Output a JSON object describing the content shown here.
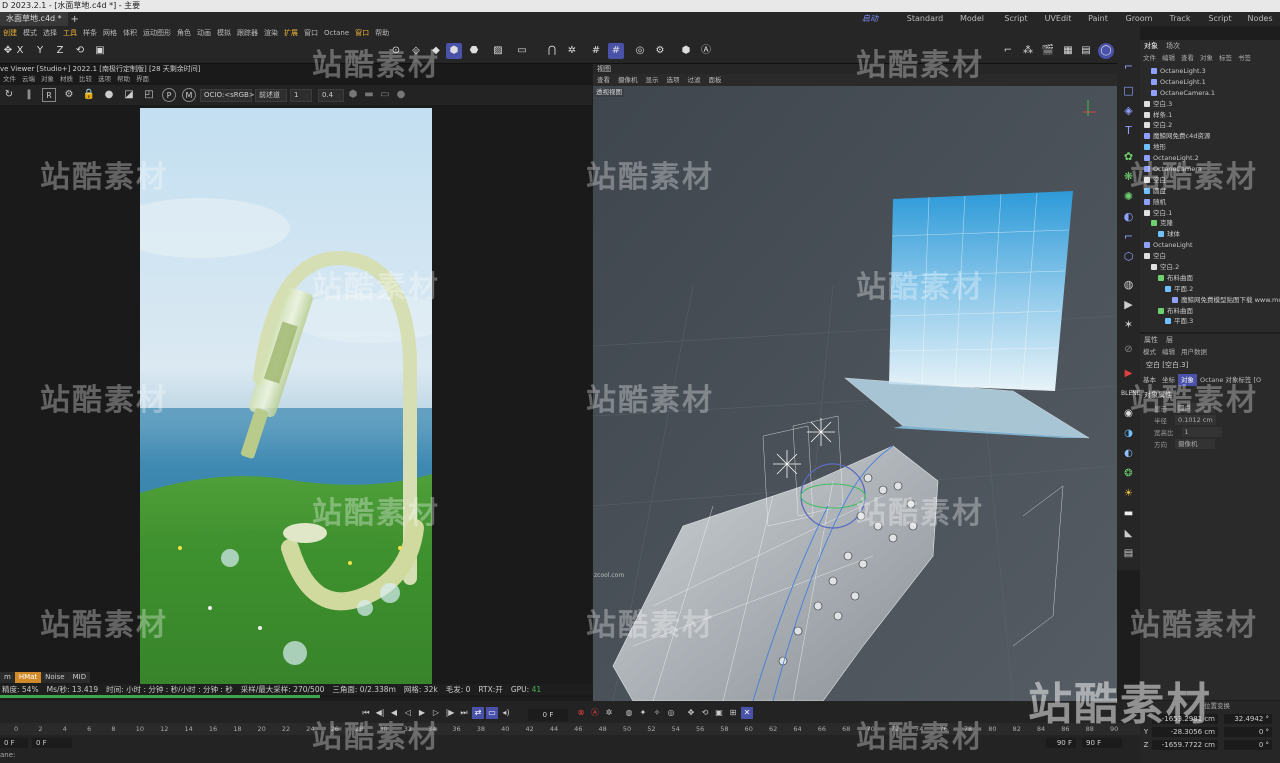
{
  "window": {
    "title": "D 2023.2.1 - [水面草地.c4d *] - 主要",
    "doc_tab": "水面草地.c4d *",
    "new_tab": "+"
  },
  "layouts": [
    "启动",
    "Standard",
    "Model",
    "Script",
    "UVEdit",
    "Paint",
    "Groom",
    "Track",
    "Script",
    "Nodes"
  ],
  "menu": [
    "创建",
    "模式",
    "选择",
    "工具",
    "样条",
    "网格",
    "体积",
    "运动图形",
    "角色",
    "动画",
    "模拟",
    "跟踪器",
    "渲染",
    "扩展",
    "窗口",
    "Octane",
    "窗口",
    "帮助"
  ],
  "toolbar_axes": [
    "X",
    "Y",
    "Z"
  ],
  "live_viewer": {
    "title": "ve Viewer [Studio+] 2022.1 [南极行定制版] [28 天剩余时间]",
    "menu": [
      "文件",
      "云端",
      "对象",
      "材质",
      "比较",
      "选项",
      "帮助",
      "界面"
    ],
    "tool_letter_r": "R",
    "tool_letter_p": "P",
    "tool_letter_m": "M",
    "ocio": "OCIO:<sRGB>",
    "tonemap": "前述道",
    "value1": "1",
    "value2": "0.4",
    "render_tabs": [
      "m",
      "HMat",
      "Noise",
      "MID"
    ],
    "status": {
      "progress_label": "精度: 54%",
      "ms": "Ms/秒: 13.419",
      "time": "时间: 小时 : 分钟 : 秒/小时 : 分钟 : 秒",
      "samples": "采样/最大采样: 270/500",
      "tris": "三角面: 0/2.338m",
      "mesh": "网格: 32k",
      "hair": "毛发: 0",
      "rtx": "RTX:开",
      "gpu": "GPU:",
      "gpu_val": "41"
    },
    "progress": 0.54
  },
  "viewport": {
    "head": "视图",
    "menu": [
      "查看",
      "摄像机",
      "显示",
      "选项",
      "过滤",
      "面板"
    ],
    "label": "透视视图",
    "credit": "zcool.com"
  },
  "object_manager": {
    "tabs": [
      "对象",
      "场次"
    ],
    "menu": [
      "文件",
      "编辑",
      "查看",
      "对象",
      "标签",
      "书签"
    ],
    "items": [
      {
        "name": "OctaneLight.3",
        "indent": 1,
        "color": "#8fa0ff"
      },
      {
        "name": "OctaneLight.1",
        "indent": 1,
        "color": "#8fa0ff"
      },
      {
        "name": "OctaneCamera.1",
        "indent": 1,
        "color": "#8fa0ff"
      },
      {
        "name": "空白.3",
        "indent": 0,
        "color": "#e0e0e0"
      },
      {
        "name": "样条.1",
        "indent": 0,
        "color": "#e0e0e0"
      },
      {
        "name": "空白.2",
        "indent": 0,
        "color": "#e0e0e0"
      },
      {
        "name": "魔鲸网免费c4d资源",
        "indent": 0,
        "color": "#8fa0ff"
      },
      {
        "name": "地形",
        "indent": 0,
        "color": "#6fc0ff"
      },
      {
        "name": "OctaneLight.2",
        "indent": 0,
        "color": "#8fa0ff"
      },
      {
        "name": "OctaneCamera",
        "indent": 0,
        "color": "#8fa0ff"
      },
      {
        "name": "空白",
        "indent": 0,
        "color": "#e0e0e0"
      },
      {
        "name": "圆盘",
        "indent": 0,
        "color": "#6fc0ff"
      },
      {
        "name": "随机",
        "indent": 0,
        "color": "#8fa0ff"
      },
      {
        "name": "空白.1",
        "indent": 0,
        "color": "#e0e0e0"
      },
      {
        "name": "克隆",
        "indent": 1,
        "color": "#6fd06f"
      },
      {
        "name": "球体",
        "indent": 2,
        "color": "#6fc0ff"
      },
      {
        "name": "OctaneLight",
        "indent": 0,
        "color": "#8fa0ff"
      },
      {
        "name": "空白",
        "indent": 0,
        "color": "#e0e0e0"
      },
      {
        "name": "空白.2",
        "indent": 1,
        "color": "#e0e0e0"
      },
      {
        "name": "布料曲面",
        "indent": 2,
        "color": "#6fd06f"
      },
      {
        "name": "平面.2",
        "indent": 3,
        "color": "#6fc0ff"
      },
      {
        "name": "魔鲸网免费模型贴图下载 www.moo",
        "indent": 4,
        "color": "#8fa0ff"
      },
      {
        "name": "布料曲面",
        "indent": 2,
        "color": "#6fd06f"
      },
      {
        "name": "平面.3",
        "indent": 3,
        "color": "#6fc0ff"
      }
    ]
  },
  "attributes": {
    "tabs": [
      "属性",
      "层"
    ],
    "menu": [
      "模式",
      "编辑",
      "用户数据"
    ],
    "object_name": "空白 [空白.3]",
    "subtabs": [
      "基本",
      "坐标",
      "对象",
      "Octane 对象标签 [O"
    ],
    "section": "对象属性",
    "props": [
      {
        "label": "显示",
        "value": "圆点"
      },
      {
        "label": "半径",
        "value": "0.1012 cm"
      },
      {
        "label": "宽高比",
        "value": "1"
      },
      {
        "label": "方向",
        "value": "摄像机"
      }
    ]
  },
  "timeline": {
    "ticks": [
      "0",
      "2",
      "4",
      "6",
      "8",
      "10",
      "12",
      "14",
      "16",
      "18",
      "20",
      "22",
      "24",
      "26",
      "28",
      "30",
      "32",
      "34",
      "36",
      "38",
      "40",
      "42",
      "44",
      "46",
      "48",
      "50",
      "52",
      "54",
      "56",
      "58",
      "60",
      "62",
      "64",
      "66",
      "68",
      "70",
      "72",
      "74",
      "76",
      "78",
      "80",
      "82",
      "84",
      "86",
      "88",
      "90"
    ],
    "current_frame": "0 F",
    "start": "0 F",
    "start2": "0 F",
    "end": "90 F",
    "end2": "90 F",
    "hint": "ane:"
  },
  "coordinates": {
    "header": "位置变换",
    "x": "-1653.2981 cm",
    "x2": "32.4942 °",
    "y": "-28.3056 cm",
    "y2": "0 °",
    "z": "-1659.7722 cm",
    "z2": "0 °",
    "y_axis": "Y",
    "z_axis": "Z"
  },
  "watermark": "站酷素材",
  "colors": {
    "accent": "#4a51a8",
    "icon": "#8fa0ff",
    "progress": "#3ca54a",
    "menu_highlight": "#f0b43c",
    "render_tab": "#d08a2a"
  }
}
